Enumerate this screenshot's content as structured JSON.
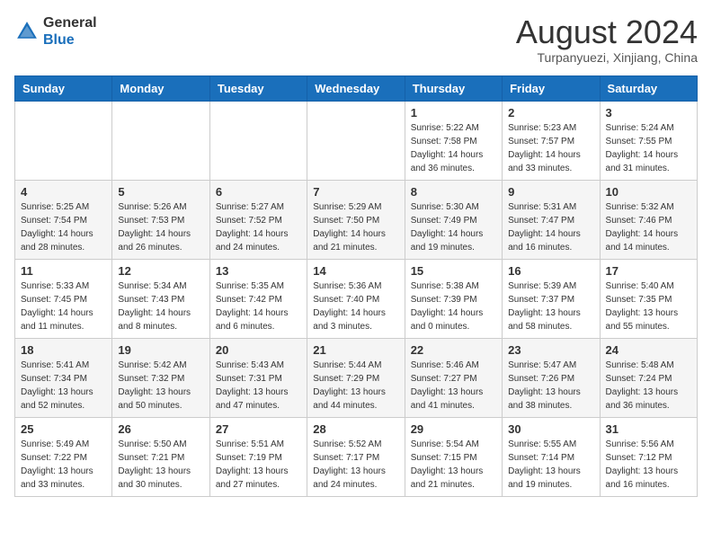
{
  "header": {
    "logo_line1": "General",
    "logo_line2": "Blue",
    "month": "August 2024",
    "location": "Turpanyuezi, Xinjiang, China"
  },
  "days_of_week": [
    "Sunday",
    "Monday",
    "Tuesday",
    "Wednesday",
    "Thursday",
    "Friday",
    "Saturday"
  ],
  "weeks": [
    [
      {
        "day": "",
        "info": ""
      },
      {
        "day": "",
        "info": ""
      },
      {
        "day": "",
        "info": ""
      },
      {
        "day": "",
        "info": ""
      },
      {
        "day": "1",
        "info": "Sunrise: 5:22 AM\nSunset: 7:58 PM\nDaylight: 14 hours\nand 36 minutes."
      },
      {
        "day": "2",
        "info": "Sunrise: 5:23 AM\nSunset: 7:57 PM\nDaylight: 14 hours\nand 33 minutes."
      },
      {
        "day": "3",
        "info": "Sunrise: 5:24 AM\nSunset: 7:55 PM\nDaylight: 14 hours\nand 31 minutes."
      }
    ],
    [
      {
        "day": "4",
        "info": "Sunrise: 5:25 AM\nSunset: 7:54 PM\nDaylight: 14 hours\nand 28 minutes."
      },
      {
        "day": "5",
        "info": "Sunrise: 5:26 AM\nSunset: 7:53 PM\nDaylight: 14 hours\nand 26 minutes."
      },
      {
        "day": "6",
        "info": "Sunrise: 5:27 AM\nSunset: 7:52 PM\nDaylight: 14 hours\nand 24 minutes."
      },
      {
        "day": "7",
        "info": "Sunrise: 5:29 AM\nSunset: 7:50 PM\nDaylight: 14 hours\nand 21 minutes."
      },
      {
        "day": "8",
        "info": "Sunrise: 5:30 AM\nSunset: 7:49 PM\nDaylight: 14 hours\nand 19 minutes."
      },
      {
        "day": "9",
        "info": "Sunrise: 5:31 AM\nSunset: 7:47 PM\nDaylight: 14 hours\nand 16 minutes."
      },
      {
        "day": "10",
        "info": "Sunrise: 5:32 AM\nSunset: 7:46 PM\nDaylight: 14 hours\nand 14 minutes."
      }
    ],
    [
      {
        "day": "11",
        "info": "Sunrise: 5:33 AM\nSunset: 7:45 PM\nDaylight: 14 hours\nand 11 minutes."
      },
      {
        "day": "12",
        "info": "Sunrise: 5:34 AM\nSunset: 7:43 PM\nDaylight: 14 hours\nand 8 minutes."
      },
      {
        "day": "13",
        "info": "Sunrise: 5:35 AM\nSunset: 7:42 PM\nDaylight: 14 hours\nand 6 minutes."
      },
      {
        "day": "14",
        "info": "Sunrise: 5:36 AM\nSunset: 7:40 PM\nDaylight: 14 hours\nand 3 minutes."
      },
      {
        "day": "15",
        "info": "Sunrise: 5:38 AM\nSunset: 7:39 PM\nDaylight: 14 hours\nand 0 minutes."
      },
      {
        "day": "16",
        "info": "Sunrise: 5:39 AM\nSunset: 7:37 PM\nDaylight: 13 hours\nand 58 minutes."
      },
      {
        "day": "17",
        "info": "Sunrise: 5:40 AM\nSunset: 7:35 PM\nDaylight: 13 hours\nand 55 minutes."
      }
    ],
    [
      {
        "day": "18",
        "info": "Sunrise: 5:41 AM\nSunset: 7:34 PM\nDaylight: 13 hours\nand 52 minutes."
      },
      {
        "day": "19",
        "info": "Sunrise: 5:42 AM\nSunset: 7:32 PM\nDaylight: 13 hours\nand 50 minutes."
      },
      {
        "day": "20",
        "info": "Sunrise: 5:43 AM\nSunset: 7:31 PM\nDaylight: 13 hours\nand 47 minutes."
      },
      {
        "day": "21",
        "info": "Sunrise: 5:44 AM\nSunset: 7:29 PM\nDaylight: 13 hours\nand 44 minutes."
      },
      {
        "day": "22",
        "info": "Sunrise: 5:46 AM\nSunset: 7:27 PM\nDaylight: 13 hours\nand 41 minutes."
      },
      {
        "day": "23",
        "info": "Sunrise: 5:47 AM\nSunset: 7:26 PM\nDaylight: 13 hours\nand 38 minutes."
      },
      {
        "day": "24",
        "info": "Sunrise: 5:48 AM\nSunset: 7:24 PM\nDaylight: 13 hours\nand 36 minutes."
      }
    ],
    [
      {
        "day": "25",
        "info": "Sunrise: 5:49 AM\nSunset: 7:22 PM\nDaylight: 13 hours\nand 33 minutes."
      },
      {
        "day": "26",
        "info": "Sunrise: 5:50 AM\nSunset: 7:21 PM\nDaylight: 13 hours\nand 30 minutes."
      },
      {
        "day": "27",
        "info": "Sunrise: 5:51 AM\nSunset: 7:19 PM\nDaylight: 13 hours\nand 27 minutes."
      },
      {
        "day": "28",
        "info": "Sunrise: 5:52 AM\nSunset: 7:17 PM\nDaylight: 13 hours\nand 24 minutes."
      },
      {
        "day": "29",
        "info": "Sunrise: 5:54 AM\nSunset: 7:15 PM\nDaylight: 13 hours\nand 21 minutes."
      },
      {
        "day": "30",
        "info": "Sunrise: 5:55 AM\nSunset: 7:14 PM\nDaylight: 13 hours\nand 19 minutes."
      },
      {
        "day": "31",
        "info": "Sunrise: 5:56 AM\nSunset: 7:12 PM\nDaylight: 13 hours\nand 16 minutes."
      }
    ]
  ]
}
